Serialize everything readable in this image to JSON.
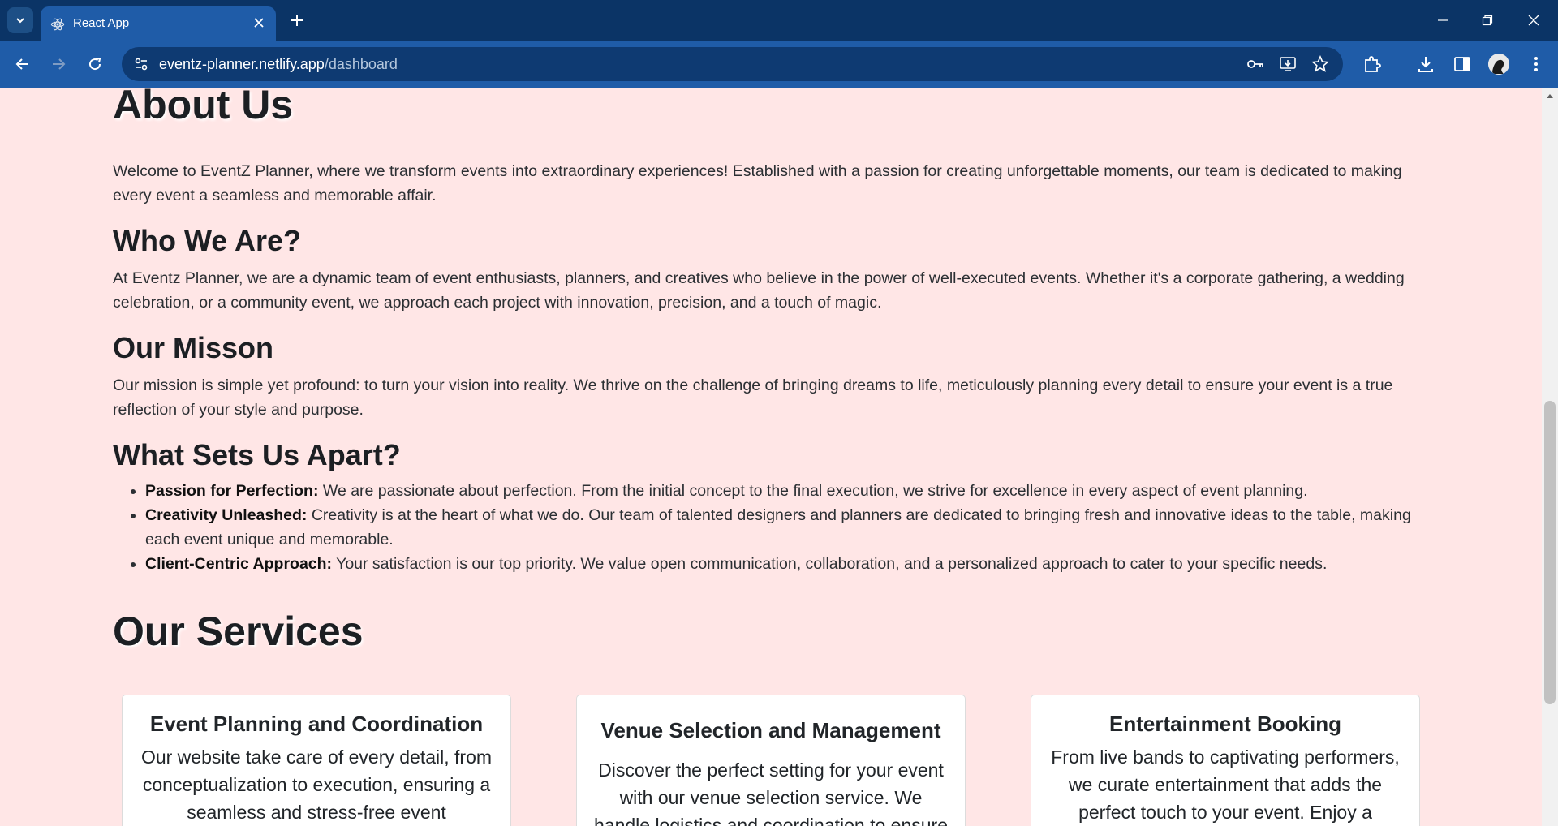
{
  "browser": {
    "tab_title": "React App",
    "url_host": "eventz-planner.netlify.app",
    "url_path": "/dashboard"
  },
  "about": {
    "heading": "About Us",
    "intro": "Welcome to EventZ Planner, where we transform events into extraordinary experiences! Established with a passion for creating unforgettable moments, our team is dedicated to making every event a seamless and memorable affair.",
    "who_heading": "Who We Are?",
    "who_text": "At Eventz Planner, we are a dynamic team of event enthusiasts, planners, and creatives who believe in the power of well-executed events. Whether it's a corporate gathering, a wedding celebration, or a community event, we approach each project with innovation, precision, and a touch of magic.",
    "mission_heading": "Our Misson",
    "mission_text": "Our mission is simple yet profound: to turn your vision into reality. We thrive on the challenge of bringing dreams to life, meticulously planning every detail to ensure your event is a true reflection of your style and purpose.",
    "apart_heading": "What Sets Us Apart?",
    "features": [
      {
        "title": "Passion for Perfection:",
        "text": " We are passionate about perfection. From the initial concept to the final execution, we strive for excellence in every aspect of event planning."
      },
      {
        "title": "Creativity Unleashed:",
        "text": " Creativity is at the heart of what we do. Our team of talented designers and planners are dedicated to bringing fresh and innovative ideas to the table, making each event unique and memorable."
      },
      {
        "title": "Client-Centric Approach:",
        "text": " Your satisfaction is our top priority. We value open communication, collaboration, and a personalized approach to cater to your specific needs."
      }
    ]
  },
  "services": {
    "heading": "Our Services",
    "cards": [
      {
        "title": "Event Planning and Coordination",
        "text": "Our website take care of every detail, from conceptualization to execution, ensuring a seamless and stress-free event"
      },
      {
        "title": "Venue Selection and Management",
        "text": "Discover the perfect setting for your event with our venue selection service. We handle logistics and coordination to ensure your"
      },
      {
        "title": "Entertainment Booking",
        "text": "From live bands to captivating performers, we curate entertainment that adds the perfect touch to your event. Enjoy a"
      }
    ]
  }
}
